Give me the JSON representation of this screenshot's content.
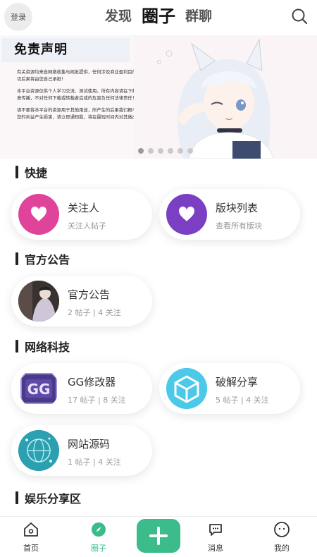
{
  "header": {
    "login_label": "登录",
    "tabs": [
      {
        "label": "发现",
        "active": false
      },
      {
        "label": "圈子",
        "active": true
      },
      {
        "label": "群聊",
        "active": false
      }
    ],
    "search_icon": "search-icon"
  },
  "banner": {
    "title": "免责声明",
    "paragraphs": [
      "有关资源均来自网络收集与网友提供，任何涉及商业盈利目的的均不得使用，否则产生的一切后果将由您自己承担！",
      "本平台资源仅供个人学习交流、测试使用。所有内容请在下载后24小时内删除，禁止非法恶意传播，不对任何下载或转载者造成的危害负任何法律责任！也请大家支持，购买正版！",
      "请不要将本平台的资源用于其他用途，所产生的后果我们概不负责！ 如果本站存在的内容对您的利益产生损害，请立即通知我，将在最短时间内对其做出删除处理。"
    ],
    "dot_count": 6,
    "active_dot": 0
  },
  "sections": [
    {
      "title": "快捷",
      "cards": [
        {
          "name": "关注人",
          "sub": "关注人帖子",
          "icon": "heart-icon",
          "color": "#e0449a"
        },
        {
          "name": "版块列表",
          "sub": "查看所有版块",
          "icon": "heart-icon",
          "color": "#7b3fc4"
        }
      ]
    },
    {
      "title": "官方公告",
      "cards": [
        {
          "name": "官方公告",
          "sub": "2 帖子 | 4 关注",
          "icon": "announcement-image-icon"
        }
      ]
    },
    {
      "title": "网络科技",
      "cards": [
        {
          "name": "GG修改器",
          "sub": "17 帖子 | 8 关注",
          "icon": "gg-logo-icon"
        },
        {
          "name": "破解分享",
          "sub": "5 帖子 | 4 关注",
          "icon": "cube-icon"
        },
        {
          "name": "网站源码",
          "sub": "1 帖子 | 4 关注",
          "icon": "tech-globe-icon"
        }
      ]
    },
    {
      "title": "娱乐分享区",
      "cards": []
    }
  ],
  "bottom_nav": [
    {
      "label": "首页",
      "icon": "home-icon",
      "active": false
    },
    {
      "label": "圈子",
      "icon": "compass-icon",
      "active": true
    },
    {
      "label": "",
      "icon": "plus-icon",
      "active": false
    },
    {
      "label": "消息",
      "icon": "chat-icon",
      "active": false
    },
    {
      "label": "我的",
      "icon": "profile-icon",
      "active": false
    }
  ],
  "colors": {
    "accent": "#3bbc8a",
    "pink": "#e0449a",
    "purple": "#7b3fc4"
  }
}
